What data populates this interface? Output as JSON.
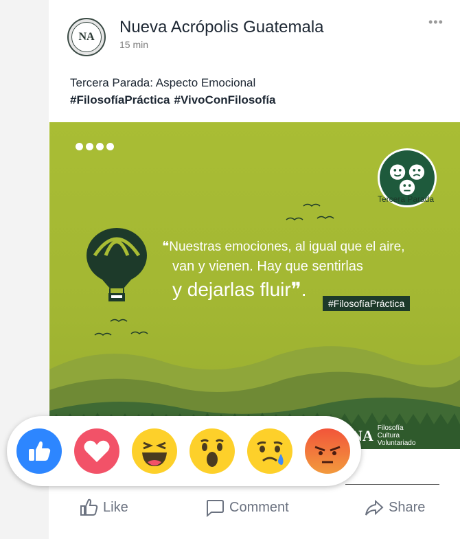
{
  "post": {
    "page_name": "Nueva Acrópolis Guatemala",
    "time": "15 min",
    "more_label": "•••",
    "text_line1": "Tercera Parada: Aspecto Emocional",
    "hashtags": [
      "#FilosofíaPráctica",
      "#VivoConFilosofía"
    ]
  },
  "image": {
    "badge_label": "Tercera Parada",
    "quote_line1": "❝Nuestras emociones, al igual que el aire,",
    "quote_line2": "van y vienen. Hay que sentirlas",
    "quote_line3": "y dejarlas fluir❞.",
    "hashtag": "#FilosofíaPráctica",
    "logo_mark": "NA",
    "logo_line1": "Filosofía",
    "logo_line2": "Cultura",
    "logo_line3": "Voluntariado",
    "colors": {
      "background": "#a9bd34",
      "dark_green": "#1d3a2a"
    }
  },
  "reactions": [
    "like",
    "love",
    "haha",
    "wow",
    "sad",
    "angry"
  ],
  "actions": {
    "like_label": "Like",
    "comment_label": "Comment",
    "share_label": "Share"
  }
}
